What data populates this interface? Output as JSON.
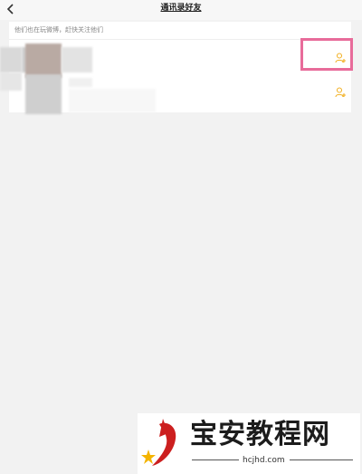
{
  "nav": {
    "title": "通讯录好友",
    "back_icon": "chevron-left-icon"
  },
  "contacts": {
    "hint": "他们也在玩微博，赶快关注他们",
    "rows": [
      {
        "name": "",
        "action_icon": "add-user-icon"
      },
      {
        "name": "",
        "action_icon": "add-user-icon"
      }
    ]
  },
  "colors": {
    "accent": "#f2b227",
    "highlight": "#e86b9a"
  },
  "watermark": {
    "title": "宝安教程网",
    "site": "hcjhd.com"
  }
}
